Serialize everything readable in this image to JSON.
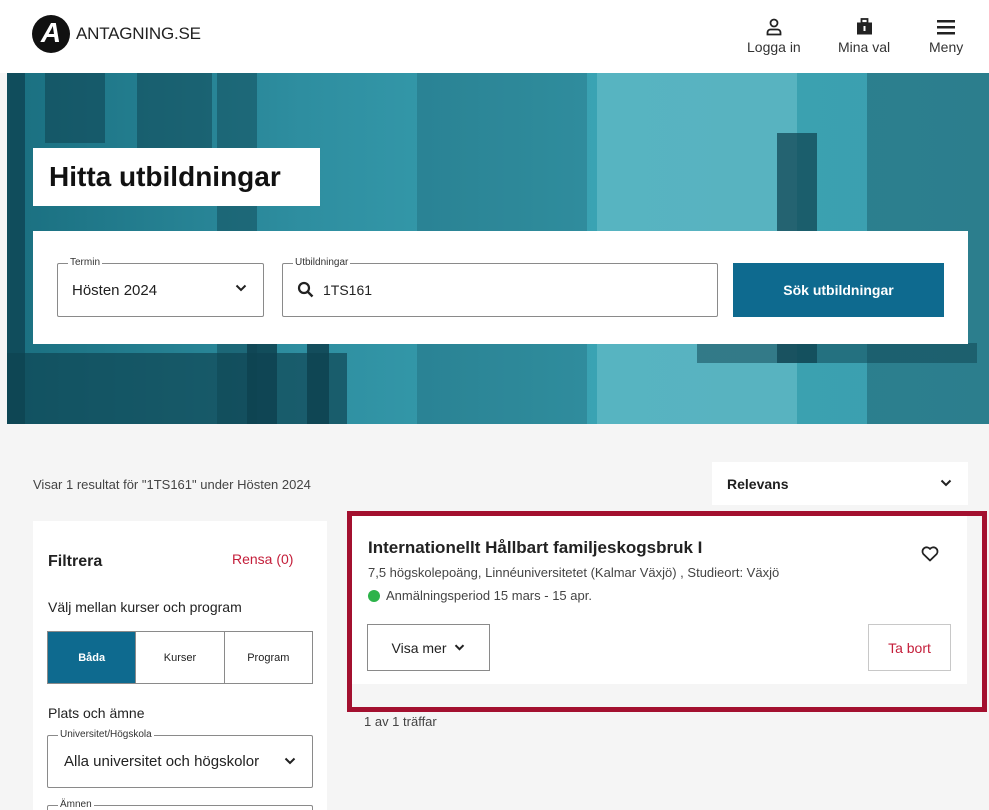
{
  "header": {
    "logo_text": "ANTAGNING.SE",
    "logo_letter": "A",
    "login_label": "Logga in",
    "mina_val_label": "Mina val",
    "menu_label": "Meny"
  },
  "hero": {
    "title": "Hitta utbildningar"
  },
  "search": {
    "termin_legend": "Termin",
    "termin_value": "Hösten 2024",
    "utb_legend": "Utbildningar",
    "utb_value": "1TS161",
    "submit_label": "Sök utbildningar"
  },
  "results": {
    "info": "Visar 1 resultat för \"1TS161\" under Hösten 2024",
    "sort_label": "Relevans",
    "count_text": "1 av 1 träffar"
  },
  "filter": {
    "title": "Filtrera",
    "clear_label": "Rensa (0)",
    "type_heading": "Välj mellan kurser och program",
    "type_options": [
      "Båda",
      "Kurser",
      "Program"
    ],
    "type_selected": "Båda",
    "place_heading": "Plats och ämne",
    "univ_legend": "Universitet/Högskola",
    "univ_value": "Alla universitet och högskolor",
    "subject_legend": "Ämnen"
  },
  "card": {
    "name": "Internationellt Hållbart familjeskogsbruk I",
    "meta": "7,5 högskolepoäng, Linnéuniversitetet (Kalmar Växjö) , Studieort: Växjö",
    "period": "Anmälningsperiod 15 mars - 15 apr.",
    "visa_label": "Visa mer",
    "remove_label": "Ta bort"
  },
  "colors": {
    "primary": "#0e6a8f",
    "danger": "#c41e3a",
    "highlight": "#a3102f",
    "status_open": "#2db34a"
  }
}
